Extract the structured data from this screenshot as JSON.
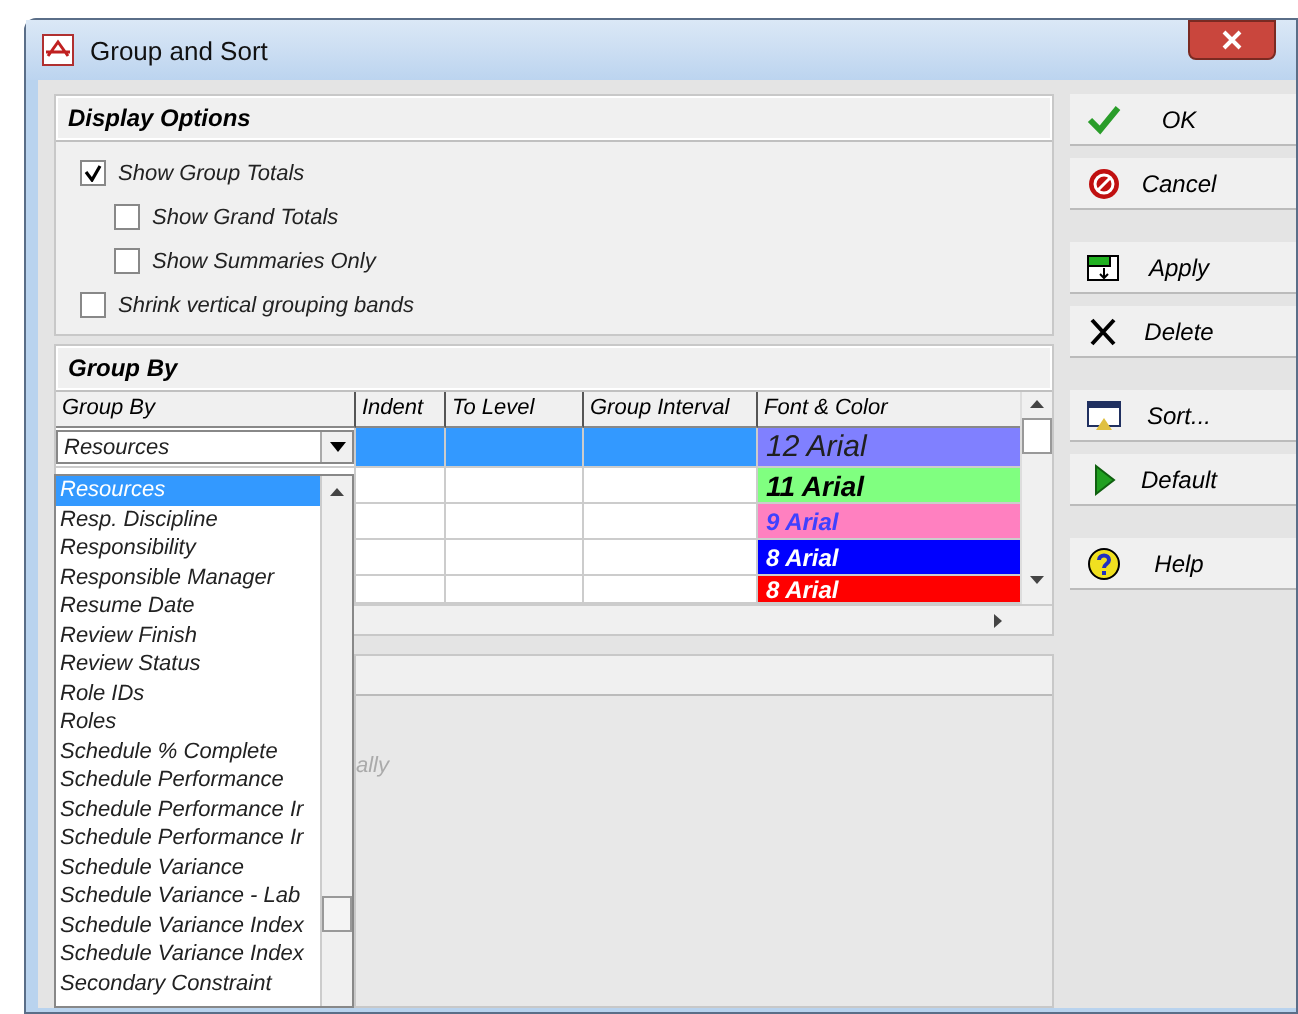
{
  "window": {
    "title": "Group and Sort"
  },
  "display_options": {
    "title": "Display Options",
    "options": [
      {
        "label": "Show Group Totals",
        "checked": true,
        "indented": false
      },
      {
        "label": "Show Grand Totals",
        "checked": false,
        "indented": true
      },
      {
        "label": "Show Summaries Only",
        "checked": false,
        "indented": true
      },
      {
        "label": "Shrink vertical grouping bands",
        "checked": false,
        "indented": false
      }
    ]
  },
  "group_by": {
    "title": "Group By",
    "columns": [
      "Group By",
      "Indent",
      "To Level",
      "Group Interval",
      "Font & Color"
    ],
    "combo": {
      "value": "Resources"
    },
    "rows": [
      {
        "selected": true,
        "font_color": {
          "text": "12 Arial",
          "kind": "large",
          "color": "#8080ff"
        }
      },
      {
        "selected": false,
        "font_color": {
          "text": "11 Arial",
          "kind": "bold",
          "color": "#80ff80"
        }
      },
      {
        "selected": false,
        "font_color": {
          "text": "9 Arial",
          "kind": "small",
          "color": "#ff80c0"
        }
      },
      {
        "selected": false,
        "font_color": {
          "text": "8 Arial",
          "kind": "small",
          "color": "#0000ff"
        }
      },
      {
        "selected": false,
        "font_color": {
          "text": "8 Arial",
          "kind": "small",
          "color": "#ff0000"
        }
      }
    ]
  },
  "dropdown_list": {
    "items": [
      {
        "label": "Resources",
        "selected": true
      },
      {
        "label": "Resp. Discipline",
        "selected": false
      },
      {
        "label": "Responsibility",
        "selected": false
      },
      {
        "label": "Responsible Manager",
        "selected": false
      },
      {
        "label": "Resume Date",
        "selected": false
      },
      {
        "label": "Review Finish",
        "selected": false
      },
      {
        "label": "Review Status",
        "selected": false
      },
      {
        "label": "Role IDs",
        "selected": false
      },
      {
        "label": "Roles",
        "selected": false
      },
      {
        "label": "Schedule % Complete",
        "selected": false
      },
      {
        "label": "Schedule Performance",
        "selected": false
      },
      {
        "label": "Schedule Performance Ir",
        "selected": false
      },
      {
        "label": "Schedule Performance Ir",
        "selected": false
      },
      {
        "label": "Schedule Variance",
        "selected": false
      },
      {
        "label": "Schedule Variance - Lab",
        "selected": false
      },
      {
        "label": "Schedule Variance Index",
        "selected": false
      },
      {
        "label": "Schedule Variance Index",
        "selected": false
      },
      {
        "label": "Secondary Constraint",
        "selected": false
      }
    ]
  },
  "lower_panel": {
    "hint": "ally"
  },
  "button_groups": [
    [
      {
        "label": "OK",
        "kind": "check"
      },
      {
        "label": "Cancel",
        "kind": "stop"
      }
    ],
    [
      {
        "label": "Apply",
        "kind": "apply"
      },
      {
        "label": "Delete",
        "kind": "x"
      }
    ],
    [
      {
        "label": "Sort...",
        "kind": "sort"
      },
      {
        "label": "Default",
        "kind": "play"
      }
    ],
    [
      {
        "label": "Help",
        "kind": "help"
      }
    ]
  ]
}
